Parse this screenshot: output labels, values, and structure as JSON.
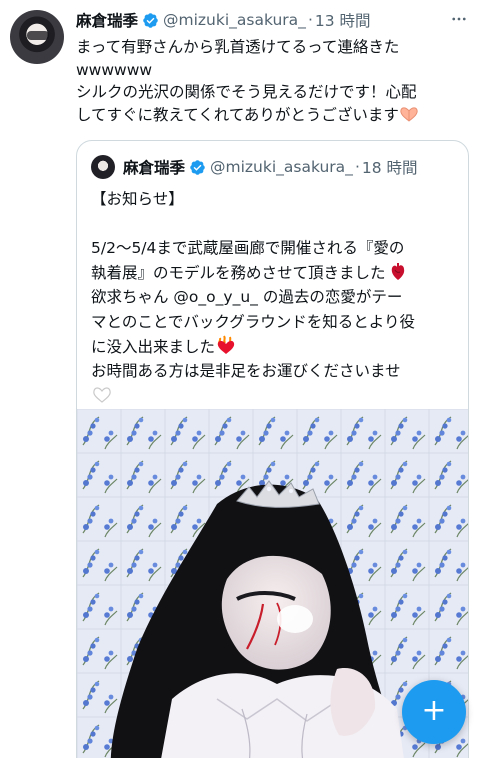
{
  "tweet": {
    "name": "麻倉瑞季",
    "handle": "@mizuki_asakura_",
    "separator": "·",
    "time": "13 時間",
    "text_lines": [
      "まって有野さんから乳首透けてるって連絡きた",
      "wwwwww",
      "シルクの光沢の関係でそう見えるだけです！心配",
      "してすぐに教えてくれてありがとうございます"
    ]
  },
  "quote": {
    "name": "麻倉瑞季",
    "handle": "@mizuki_asakura_",
    "separator": "·",
    "time": "18 時間",
    "lines": [
      "【お知らせ】",
      "",
      "5/2〜5/4まで武蔵屋画廊で開催される『愛の",
      "執着展』のモデルを務めさせて頂きました",
      "欲求ちゃん @o_o_y_u_ の過去の恋愛がテー",
      "マとのことでバックグラウンドを知るとより役",
      "に没入出来ました",
      "お時間ある方は是非足をお運びくださいませ"
    ]
  },
  "fab": {
    "label": "+"
  },
  "icons": {
    "verified": "verified-badge-icon",
    "more": "more-options-icon",
    "hands_emoji": "heart-hands-icon",
    "anatomical_heart": "anatomical-heart-icon",
    "heart_on_fire": "heart-on-fire-icon",
    "white_heart": "white-heart-icon",
    "compose": "compose-plus-icon"
  },
  "colors": {
    "accent": "#1d9bf0",
    "secondary_text": "#536471",
    "border": "#cfd9de"
  }
}
